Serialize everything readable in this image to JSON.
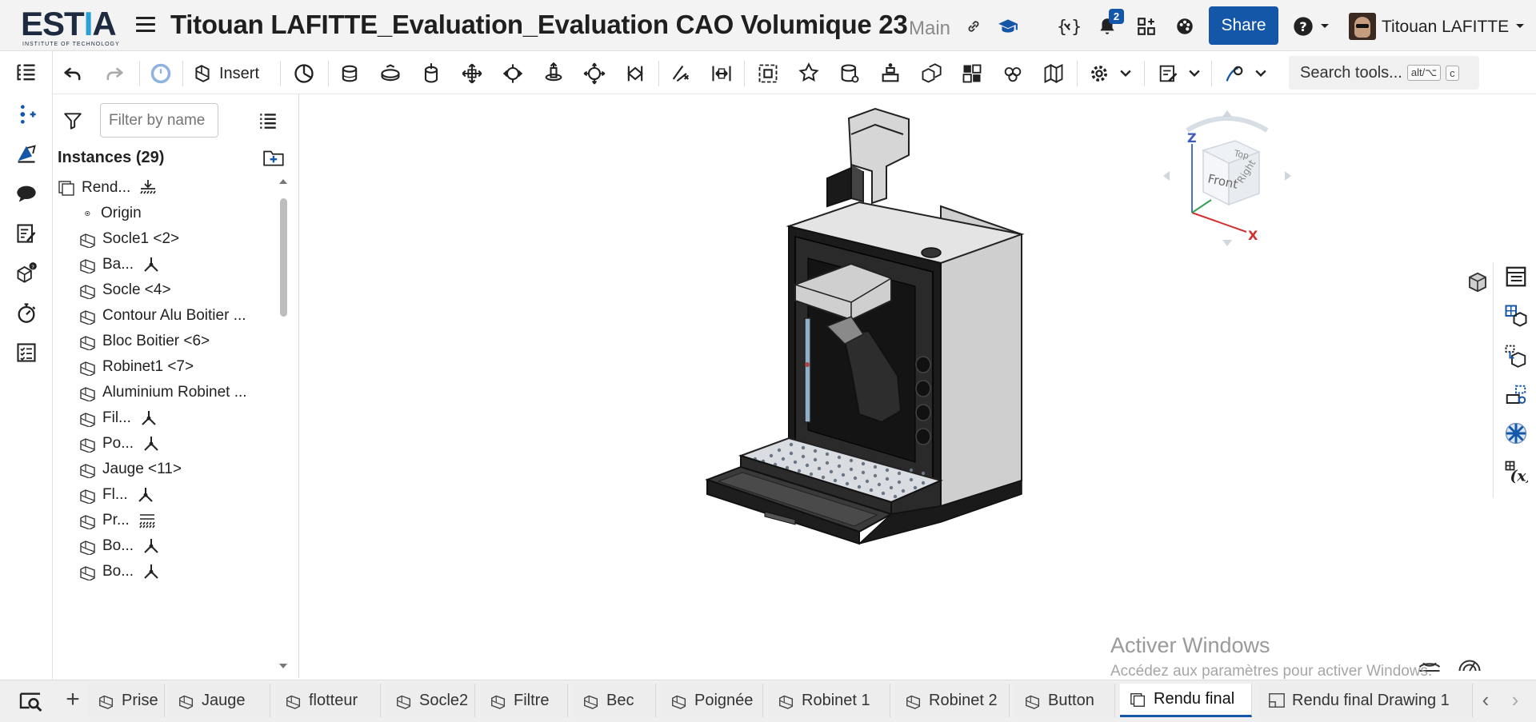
{
  "header": {
    "logo_text": "ESTIA",
    "logo_tagline": "INSTITUTE OF TECHNOLOGY",
    "document_title": "Titouan LAFITTE_Evaluation_Evaluation CAO Volumique 23",
    "branch": "Main",
    "notification_count": "2",
    "share_label": "Share",
    "user_name": "Titouan LAFITTE"
  },
  "toolbar": {
    "insert_label": "Insert",
    "search_label": "Search tools...",
    "search_shortcut_1": "alt/⌥",
    "search_shortcut_2": "c"
  },
  "panel": {
    "filter_placeholder": "Filter by name",
    "instances_title": "Instances (29)",
    "items": [
      {
        "label": "Rend...",
        "suffix": "ground-icon",
        "level": 0
      },
      {
        "label": "Origin",
        "suffix": "",
        "level": 1
      },
      {
        "label": "Socle1 <2>",
        "suffix": "",
        "level": 1
      },
      {
        "label": "Ba...",
        "suffix": "mate-icon",
        "level": 1
      },
      {
        "label": "Socle <4>",
        "suffix": "",
        "level": 1
      },
      {
        "label": "Contour Alu Boitier ...",
        "suffix": "",
        "level": 1
      },
      {
        "label": "Bloc Boitier <6>",
        "suffix": "",
        "level": 1
      },
      {
        "label": "Robinet1 <7>",
        "suffix": "",
        "level": 1
      },
      {
        "label": "Aluminium Robinet ...",
        "suffix": "",
        "level": 1
      },
      {
        "label": "Fil...",
        "suffix": "mate-icon",
        "level": 1
      },
      {
        "label": "Po...",
        "suffix": "mate-icon",
        "level": 1
      },
      {
        "label": "Jauge <11>",
        "suffix": "",
        "level": 1
      },
      {
        "label": "Fl...",
        "suffix": "mate-icon",
        "level": 1
      },
      {
        "label": "Pr...",
        "suffix": "pattern-icon",
        "level": 1
      },
      {
        "label": "Bo...",
        "suffix": "mate-icon",
        "level": 1
      },
      {
        "label": "Bo...",
        "suffix": "mate-icon",
        "level": 1
      }
    ]
  },
  "viewcube": {
    "top": "Top",
    "front": "Front",
    "right": "Right",
    "axis_x": "X",
    "axis_z": "Z"
  },
  "watermark": {
    "line1": "Activer Windows",
    "line2": "Accédez aux paramètres pour activer Windows."
  },
  "tabs": [
    {
      "label": "Prise",
      "active": false
    },
    {
      "label": "Jauge",
      "active": false
    },
    {
      "label": "flotteur",
      "active": false
    },
    {
      "label": "Socle2",
      "active": false
    },
    {
      "label": "Filtre",
      "active": false
    },
    {
      "label": "Bec",
      "active": false
    },
    {
      "label": "Poignée",
      "active": false
    },
    {
      "label": "Robinet 1",
      "active": false
    },
    {
      "label": "Robinet 2",
      "active": false
    },
    {
      "label": "Button",
      "active": false
    },
    {
      "label": "Rendu final",
      "active": true
    },
    {
      "label": "Rendu final Drawing 1",
      "active": false
    }
  ],
  "colors": {
    "accent": "#1456a8",
    "brand_light": "#2a9fd8",
    "header_bg": "#f3f3f4"
  }
}
